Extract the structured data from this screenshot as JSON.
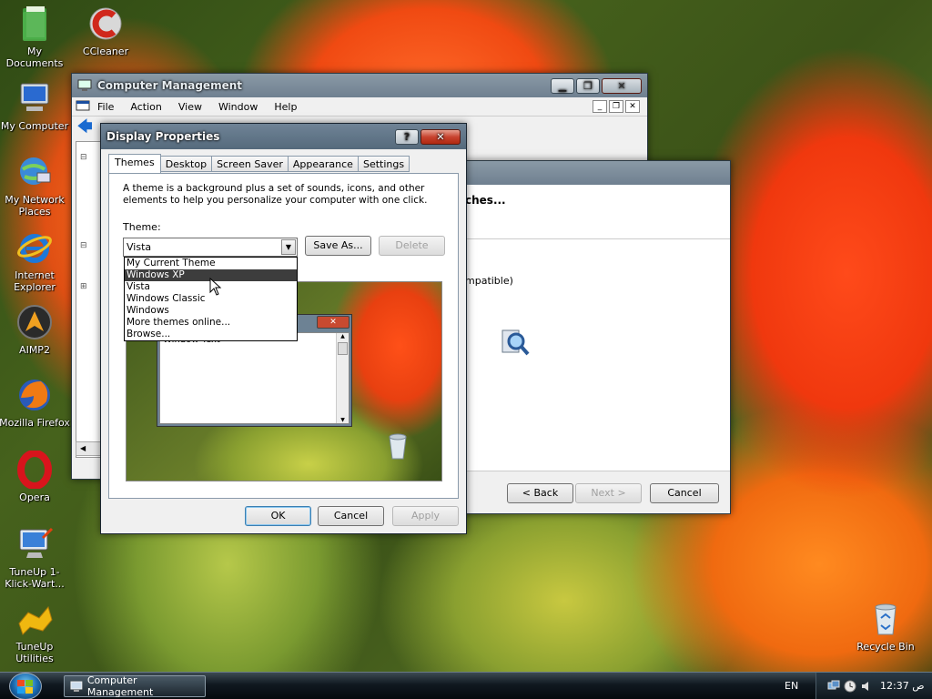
{
  "desktop": {
    "icons": [
      {
        "label": "My Documents",
        "icon": "documents-folder-icon"
      },
      {
        "label": "CCleaner",
        "icon": "ccleaner-icon"
      },
      {
        "label": "My Computer",
        "icon": "my-computer-icon"
      },
      {
        "label": "My Network Places",
        "icon": "network-places-icon"
      },
      {
        "label": "Internet Explorer",
        "icon": "internet-explorer-icon"
      },
      {
        "label": "AIMP2",
        "icon": "aimp2-icon"
      },
      {
        "label": "Mozilla Firefox",
        "icon": "firefox-icon"
      },
      {
        "label": "Opera",
        "icon": "opera-icon"
      },
      {
        "label": "TuneUp 1-Klick-Wart...",
        "icon": "tuneup-maintenance-icon"
      },
      {
        "label": "TuneUp Utilities",
        "icon": "tuneup-utilities-icon"
      },
      {
        "label": "Recycle Bin",
        "icon": "recycle-bin-icon"
      }
    ]
  },
  "computer_management": {
    "title": "Computer Management",
    "menu": [
      "File",
      "Action",
      "View",
      "Window",
      "Help"
    ]
  },
  "wizard": {
    "heading_fragment": "ches...",
    "text_fragment": "mpatible)",
    "back_label": "< Back",
    "next_label": "Next >",
    "cancel_label": "Cancel"
  },
  "display_properties": {
    "title": "Display Properties",
    "help_glyph": "?",
    "tabs": [
      "Themes",
      "Desktop",
      "Screen Saver",
      "Appearance",
      "Settings"
    ],
    "active_tab": "Themes",
    "description": "A theme is a background plus a set of sounds, icons, and other elements to help you personalize your computer with one click.",
    "theme_label": "Theme:",
    "theme_value": "Vista",
    "save_as_label": "Save As...",
    "delete_label": "Delete",
    "dropdown_options": [
      "My Current Theme",
      "Windows XP",
      "Vista",
      "Windows Classic",
      "Windows",
      "More themes online...",
      "Browse..."
    ],
    "highlighted_option": "Windows XP",
    "preview_window_text": "Window Text",
    "ok_label": "OK",
    "cancel_label": "Cancel",
    "apply_label": "Apply"
  },
  "taskbar": {
    "task_label": "Computer Management",
    "language": "EN",
    "time": "12:37 ص"
  },
  "colors": {
    "highlight": "#3d3d3d",
    "title_glass": "#7a8a96",
    "link_blue": "#0066cc"
  }
}
